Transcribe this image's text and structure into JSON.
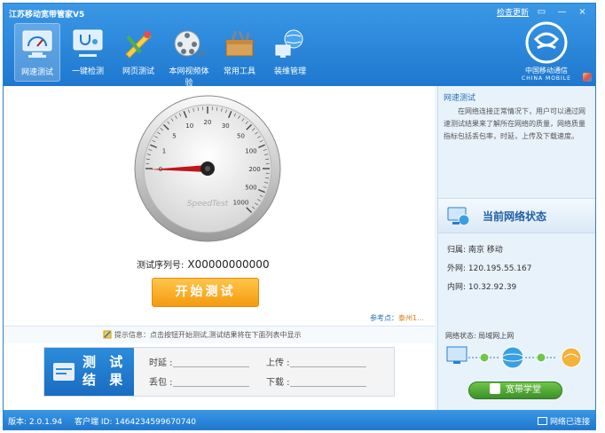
{
  "app": {
    "title": "江苏移动宽带管家V5",
    "check_update": "检查更新"
  },
  "window_controls": {
    "restore": "▭",
    "minimize": "—",
    "close": "×"
  },
  "nav": [
    {
      "label": "网速测试",
      "icon": "speedtest-monitor-icon",
      "active": true
    },
    {
      "label": "一键检测",
      "icon": "stethoscope-monitor-icon"
    },
    {
      "label": "网页测试",
      "icon": "webpage-test-icon"
    },
    {
      "label": "本网视频体验",
      "icon": "film-reel-icon"
    },
    {
      "label": "常用工具",
      "icon": "toolbox-icon"
    },
    {
      "label": "装维管理",
      "icon": "network-globe-icon"
    }
  ],
  "brand": {
    "cn": "中国移动通信",
    "en": "CHINA MOBILE"
  },
  "gauge": {
    "label": "SpeedTest",
    "ticks": [
      "0",
      "1",
      "5",
      "10",
      "20",
      "30",
      "50",
      "100",
      "200",
      "500",
      "1000"
    ],
    "value": 0
  },
  "serial": {
    "label": "测试序列号:",
    "value": "X00000000000"
  },
  "start_button": "开始测试",
  "reference": {
    "label": "参考点：",
    "city": "泰州1..."
  },
  "tip": "提示信息：点击按钮开始测试,测试结果将在下面列表中显示",
  "result": {
    "title_line1": "测 试",
    "title_line2": "结 果",
    "latency_label": "时延 :",
    "upload_label": "上传 :",
    "loss_label": "丢包 :",
    "download_label": "下载 :"
  },
  "info": {
    "title": "网速测试",
    "desc": "在网络连接正常情况下，用户可以通过网速测试结果来了解所在网络的质量，网络质量指标包括丢包率，时延，上传及下载速度。"
  },
  "status": {
    "title": "当前网络状态",
    "location": "归属: 南京 移动",
    "external_ip": "外网: 120.195.55.167",
    "internal_ip": "内网: 10.32.92.39",
    "network_state": "网络状态: 局域网上网"
  },
  "speed_button": "宽带学堂",
  "statusbar": {
    "version": "版本: 2.0.1.94",
    "client_id": "客户端 ID: 1464234599670740",
    "net_state": "网络已连接"
  },
  "colors": {
    "accent": "#1f78cf",
    "button_orange": "#f49a10",
    "needle": "#c0161c",
    "green": "#3b8f28"
  }
}
